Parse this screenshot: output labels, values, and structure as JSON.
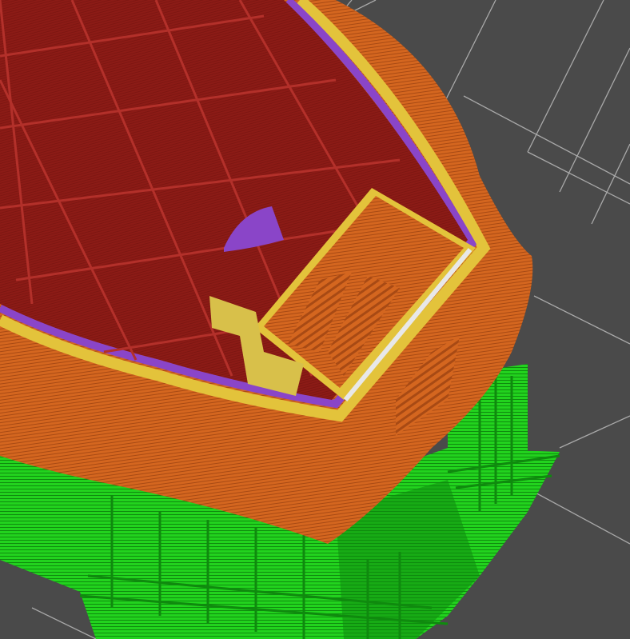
{
  "scene": {
    "description_hidden": "",
    "colors": {
      "bed_background": "#4a4a4a",
      "bed_grid_line": "#a9a9a9",
      "outer_wall": "#d4661f",
      "outer_wall_dark": "#a84a14",
      "perimeter_yellow": "#e3c33b",
      "perimeter_purple": "#8a45c8",
      "infill": "#8c1b16",
      "infill_line": "#b3302a",
      "support_green": "#22d31e",
      "support_green_dark": "#0f8a0e",
      "travel_white": "#e8e8e8",
      "bridge_blue": "#3a6fd6"
    }
  }
}
